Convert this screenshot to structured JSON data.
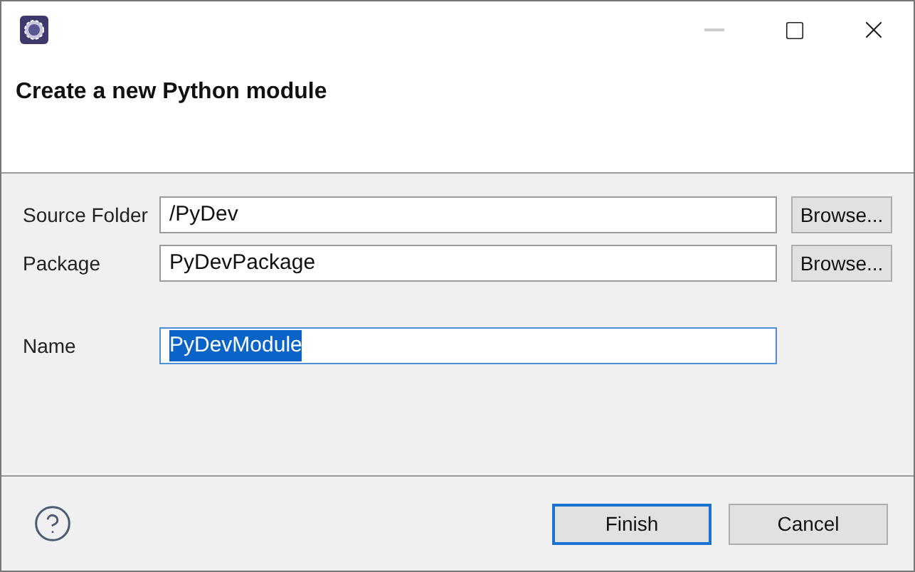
{
  "title_bar": {
    "controls": [
      {
        "kind": "minimize",
        "disabled": true
      },
      {
        "kind": "maximize",
        "disabled": false
      },
      {
        "kind": "close",
        "disabled": false
      }
    ]
  },
  "header": {
    "title": "Create a new Python module"
  },
  "fields": [
    {
      "label": "Source Folder",
      "value": "/PyDev",
      "focused": false,
      "selected": false,
      "button": "Browse..."
    },
    {
      "label": "Package",
      "value": "PyDevPackage",
      "focused": false,
      "selected": false,
      "button": "Browse..."
    },
    {
      "label": "Name",
      "value": "PyDevModule",
      "focused": true,
      "selected": true
    }
  ],
  "buttons": [
    {
      "label": "Finish",
      "default": true
    },
    {
      "label": "Cancel",
      "default": false
    }
  ]
}
